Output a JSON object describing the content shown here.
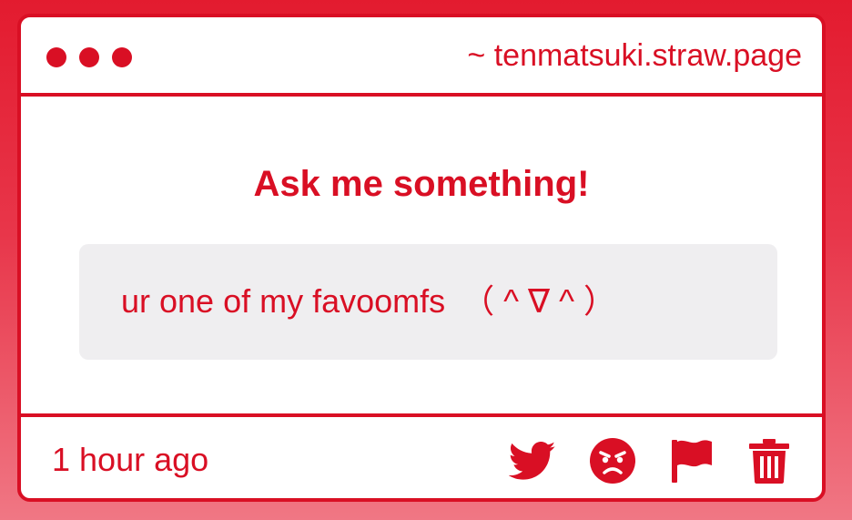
{
  "window": {
    "url": "~ tenmatsuki.straw.page"
  },
  "main": {
    "heading": "Ask me something!",
    "question": "ur one of my favoomfs　（ ^ ∇ ^ ）"
  },
  "footer": {
    "timestamp": "1 hour ago",
    "actions": [
      {
        "icon": "twitter-icon"
      },
      {
        "icon": "angry-face-icon"
      },
      {
        "icon": "flag-icon"
      },
      {
        "icon": "trash-icon"
      }
    ]
  },
  "colors": {
    "accent": "#d90f24",
    "question_bg": "#efeef0",
    "background_top": "#e31b2f",
    "background_bottom": "#f07784"
  }
}
